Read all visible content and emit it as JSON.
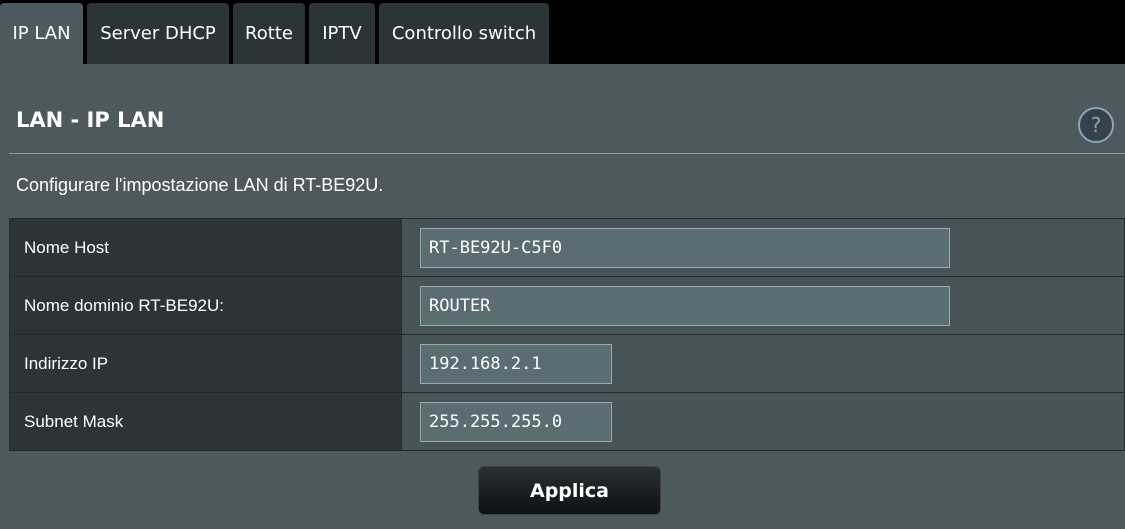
{
  "tabs": [
    {
      "label": "IP LAN",
      "active": true
    },
    {
      "label": "Server DHCP",
      "active": false
    },
    {
      "label": "Rotte",
      "active": false
    },
    {
      "label": "IPTV",
      "active": false
    },
    {
      "label": "Controllo switch",
      "active": false
    }
  ],
  "page": {
    "title": "LAN - IP LAN",
    "help_icon": "question-mark",
    "description": "Configurare l'impostazione LAN di RT-BE92U."
  },
  "fields": [
    {
      "label": "Nome Host",
      "value": "RT-BE92U-C5F0"
    },
    {
      "label": "Nome dominio RT-BE92U:",
      "value": "ROUTER"
    },
    {
      "label": "Indirizzo IP",
      "value": "192.168.2.1"
    },
    {
      "label": "Subnet Mask",
      "value": "255.255.255.0"
    }
  ],
  "apply_button": {
    "label": "Applica"
  },
  "colors": {
    "background": "#000000",
    "panel": "#4d595d",
    "active_tab": "#4d5a5f",
    "inactive_tab": "#2b3538",
    "label_cell": "#2b3538",
    "input_background": "#5a6d73"
  }
}
